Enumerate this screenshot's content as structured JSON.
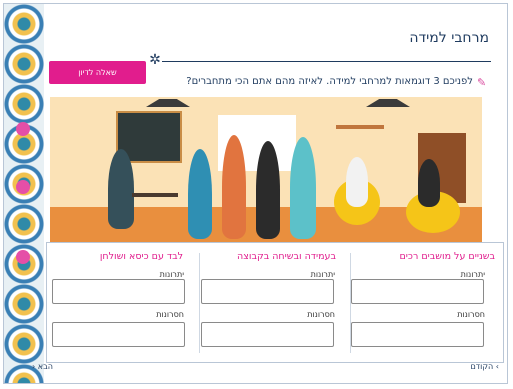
{
  "page": {
    "title": "מרחבי למידה",
    "ask_button_label": "שאלה לדיון",
    "question": "לפניכם 3 דוגמאות למרחבי למידה. לאיזה מהם אתם הכי מתחברים?",
    "illustration_alt": "איור של מרחב למידה"
  },
  "columns": [
    {
      "title": "בשניים על מושבים רכים",
      "pros_label": "יתרונות",
      "cons_label": "חסרונות",
      "pros_value": "",
      "cons_value": ""
    },
    {
      "title": "בעמידה ובשיחה בקבוצה",
      "pros_label": "יתרונות",
      "cons_label": "חסרונות",
      "pros_value": "",
      "cons_value": ""
    },
    {
      "title": "לבד עם כיסא ושולחן",
      "pros_label": "יתרונות",
      "cons_label": "חסרונות",
      "pros_value": "",
      "cons_value": ""
    }
  ],
  "nav": {
    "prev_label": "הקודם",
    "next_label": "הבא"
  },
  "colors": {
    "accent": "#e11d8d",
    "title": "#1f3b5f"
  },
  "icons": {
    "gear": "gear-icon",
    "pencil": "pencil-icon",
    "prev": "chevron-right-icon",
    "next": "chevron-left-icon"
  }
}
